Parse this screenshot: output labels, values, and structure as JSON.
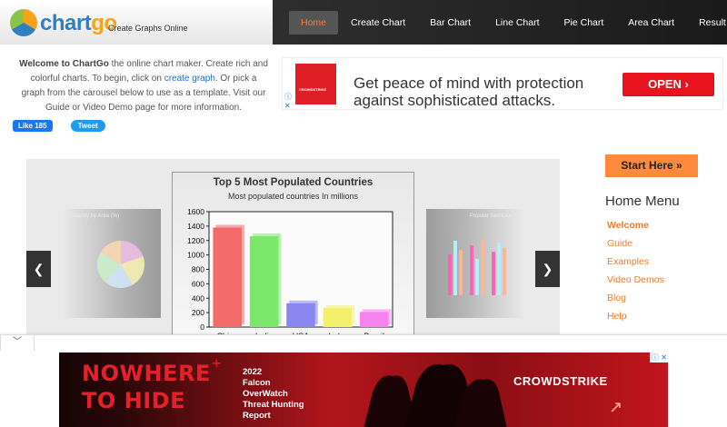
{
  "header": {
    "logo_text_a": "chart",
    "logo_text_b": "go",
    "tagline": "Create Graphs Online",
    "nav": [
      "Home",
      "Create Chart",
      "Bar Chart",
      "Line Chart",
      "Pie Chart",
      "Area Chart",
      "Result"
    ]
  },
  "intro": {
    "welcome_bold": "Welcome to ChartGo",
    "text_a": " the online chart maker. Create rich and colorful charts. To begin, click on ",
    "link": "create graph",
    "text_b": ". Or pick a graph from the carousel below to use as a template. Visit our Guide or Video Demo page for more information."
  },
  "social": {
    "like": "Like 185",
    "tweet": "Tweet"
  },
  "ad_top": {
    "brand_mini": "CROWDSTRIKE",
    "line1": "Get peace of mind with protection",
    "line2": "against sophisticated attacks.",
    "cta": "OPEN ›"
  },
  "carousel": {
    "left_thumb_title": "Country by Area (%)",
    "right_thumb_title": "Popular Services"
  },
  "chart_data": {
    "type": "bar",
    "title": "Top 5 Most Populated Countries",
    "subtitle": "Most populated countries In millions",
    "categories": [
      "China",
      "India",
      "USA",
      "Indo.",
      "Brazil"
    ],
    "values": [
      1380,
      1260,
      330,
      265,
      210
    ],
    "colors": [
      "#f26a6a",
      "#7be86b",
      "#8a88f0",
      "#f4f06e",
      "#f483f0"
    ],
    "yticks": [
      "0",
      "200",
      "400",
      "600",
      "800",
      "1000",
      "1200",
      "1400",
      "1600"
    ],
    "ylim": [
      0,
      1600
    ]
  },
  "sidebar": {
    "start": "Start Here »",
    "menu_title": "Home Menu",
    "items": [
      "Welcome",
      "Guide",
      "Examples",
      "Video Demos",
      "Blog",
      "Help"
    ]
  },
  "ad_bottom": {
    "headline_1": "NOWHERE",
    "headline_2": "TO HIDE",
    "sub_1": "2022",
    "sub_2": "Falcon",
    "sub_3": "OverWatch",
    "sub_4": "Threat Hunting",
    "sub_5": "Report",
    "brand": "CROWDSTRIKE"
  },
  "colors": {
    "accent": "#ee7c2b",
    "nav_bg": "#1a1a1a",
    "link": "#1e6fbf"
  }
}
